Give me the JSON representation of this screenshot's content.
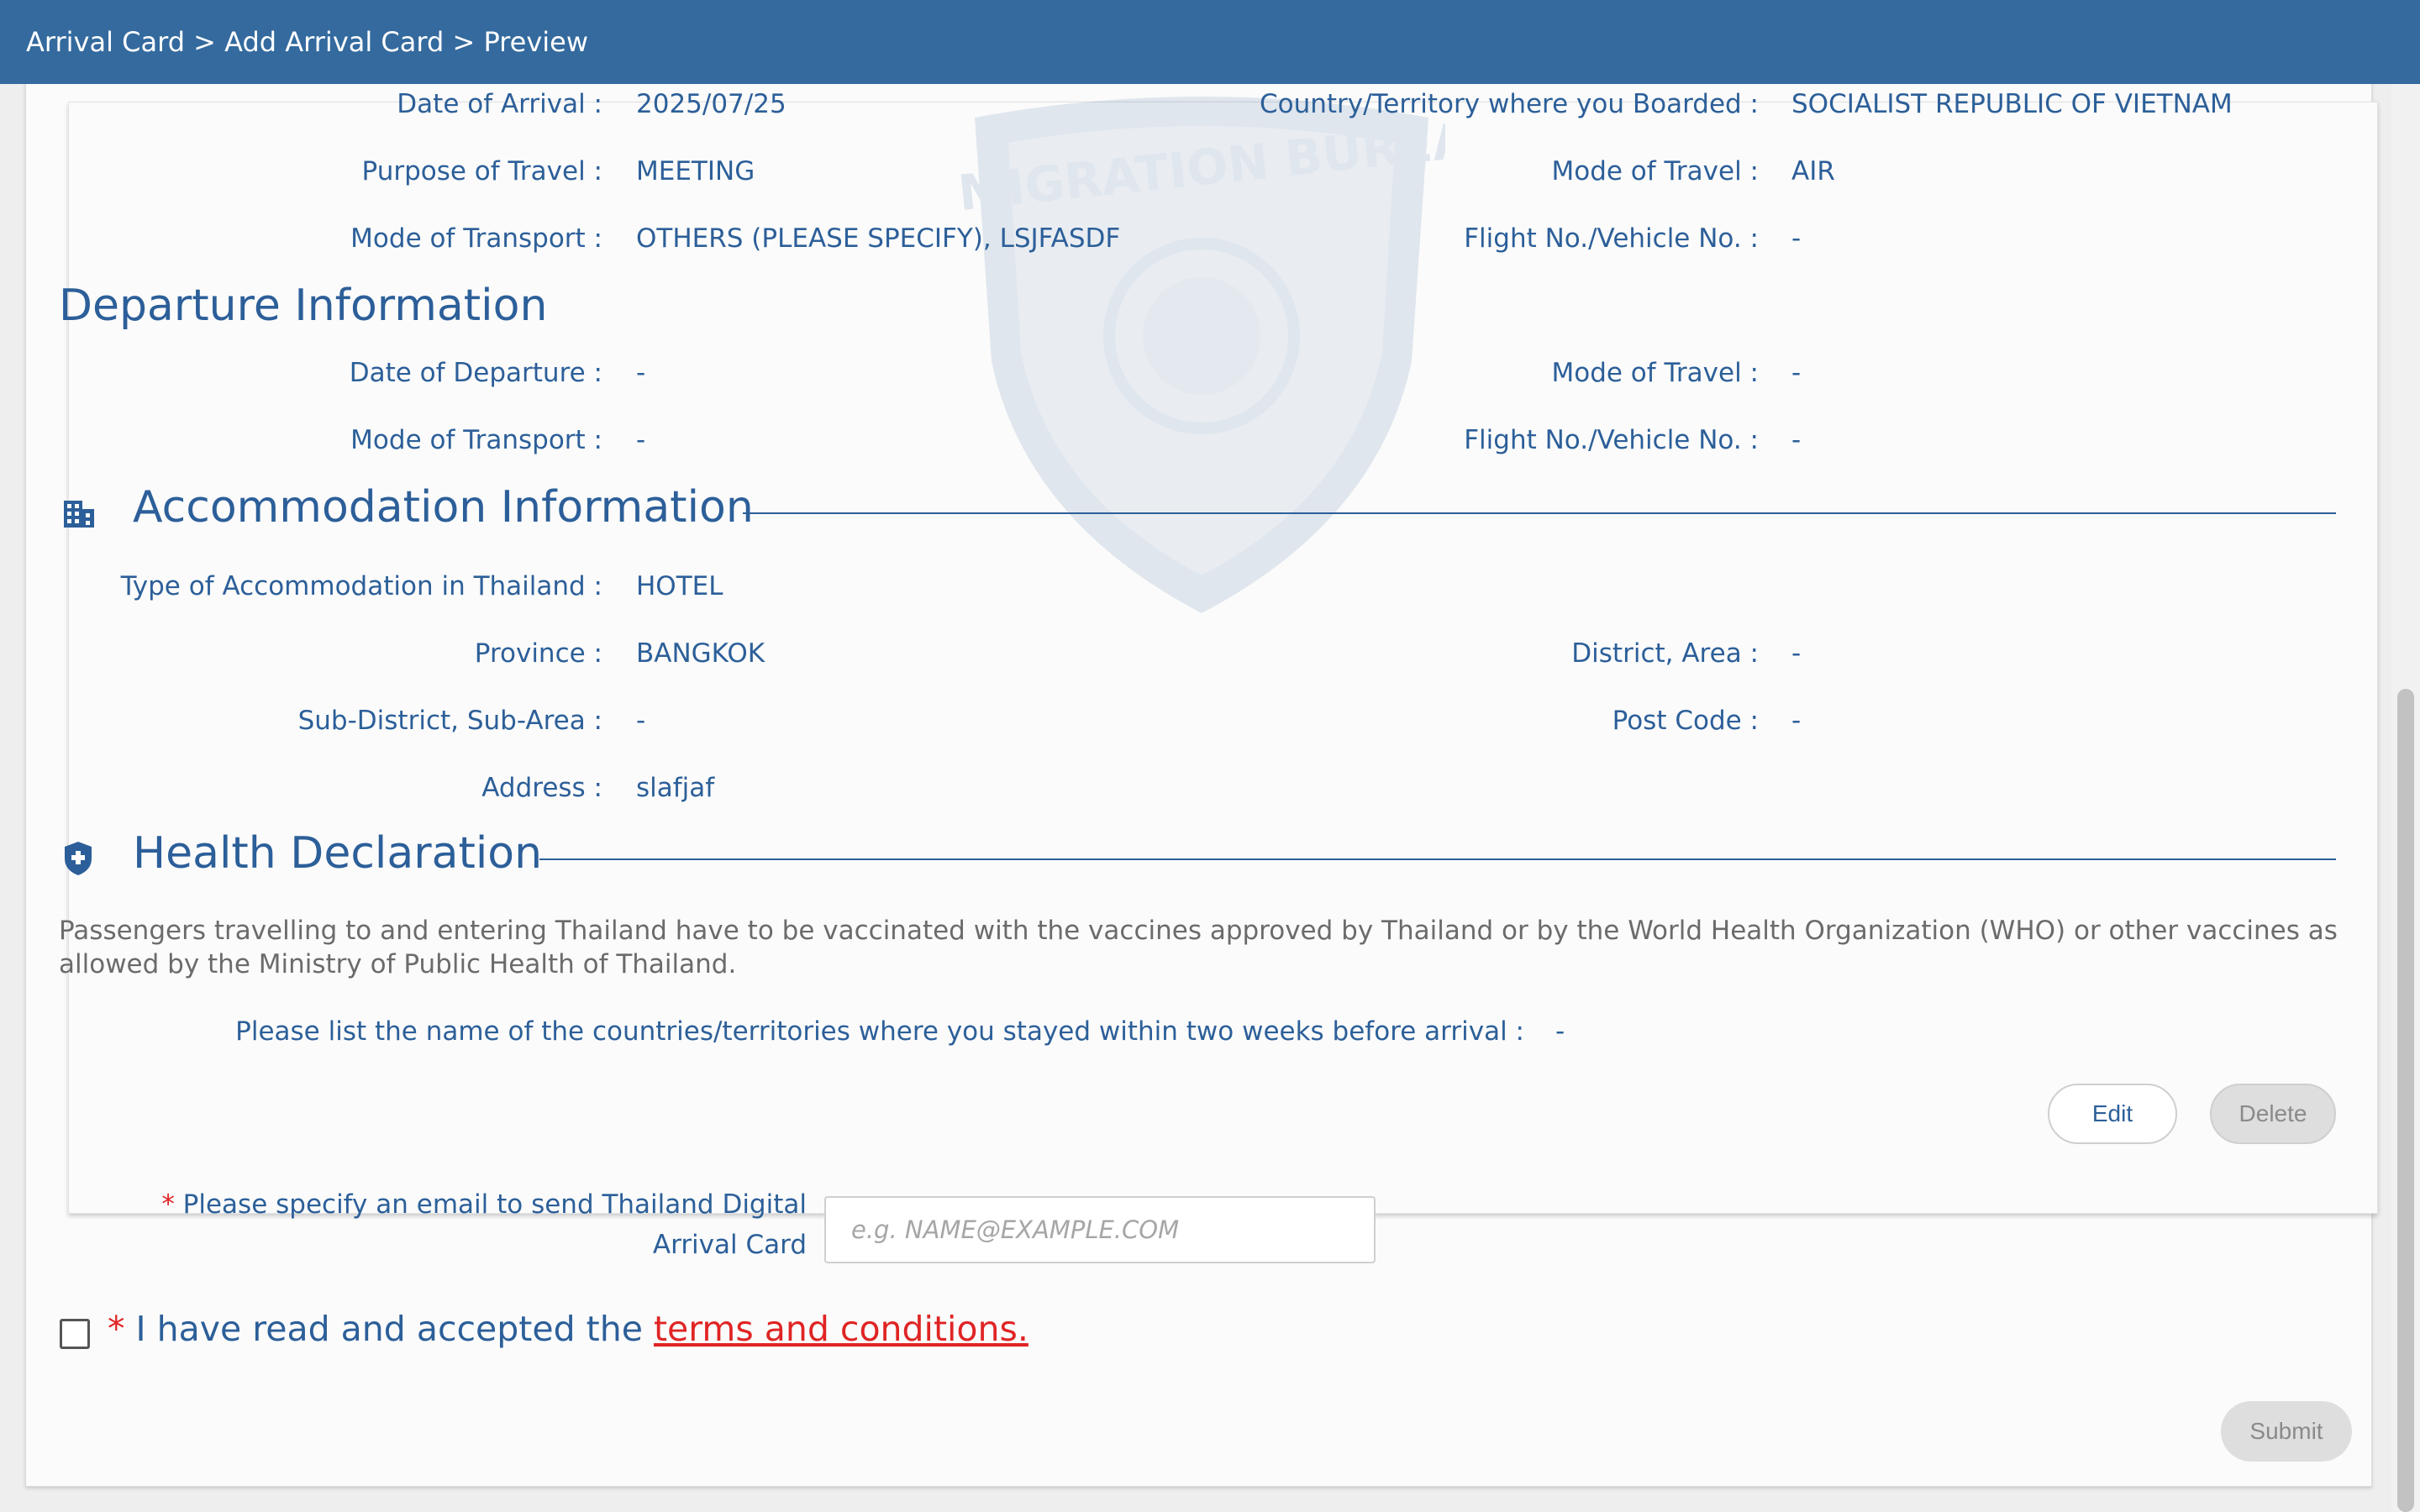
{
  "header": {
    "breadcrumb": "Arrival Card > Add Arrival Card > Preview"
  },
  "watermark": {
    "text": "IMMIGRATION BUREAU"
  },
  "arrival": {
    "rows": [
      {
        "label": "Date of Arrival :",
        "value": "2025/07/25",
        "label2": "Country/Territory where you Boarded :",
        "value2": "SOCIALIST REPUBLIC OF VIETNAM"
      },
      {
        "label": "Purpose of Travel :",
        "value": "MEETING",
        "label2": "Mode of Travel :",
        "value2": "AIR"
      },
      {
        "label": "Mode of Transport :",
        "value": "OTHERS (PLEASE SPECIFY), LSJFASDF",
        "label2": "Flight No./Vehicle No. :",
        "value2": "-"
      }
    ]
  },
  "departure": {
    "title": "Departure Information",
    "rows": [
      {
        "label": "Date of Departure :",
        "value": "-",
        "label2": "Mode of Travel :",
        "value2": "-"
      },
      {
        "label": "Mode of Transport :",
        "value": "-",
        "label2": "Flight No./Vehicle No. :",
        "value2": "-"
      }
    ]
  },
  "accommodation": {
    "title": "Accommodation Information",
    "icon": "building-icon",
    "type_label": "Type of Accommodation in Thailand :",
    "type_value": "HOTEL",
    "province_label": "Province :",
    "province_value": "BANGKOK",
    "district_label": "District, Area :",
    "district_value": "-",
    "subdistrict_label": "Sub-District, Sub-Area :",
    "subdistrict_value": "-",
    "postcode_label": "Post Code :",
    "postcode_value": "-",
    "address_label": "Address :",
    "address_value": "slafjaf"
  },
  "health": {
    "title": "Health Declaration",
    "icon": "medical-shield-icon",
    "notice": "Passengers travelling to and entering Thailand have to be vaccinated with the vaccines approved by Thailand or by the World Health Organization (WHO) or other vaccines as allowed by the Ministry of Public Health of Thailand.",
    "countries_label": "Please list the name of the countries/territories where you stayed within two weeks before arrival :",
    "countries_value": "-"
  },
  "actions": {
    "edit": "Edit",
    "delete": "Delete",
    "submit": "Submit"
  },
  "email": {
    "required_mark": "*",
    "label": "Please specify an email to send Thailand Digital Arrival Card",
    "placeholder": "e.g. NAME@EXAMPLE.COM",
    "value": ""
  },
  "terms": {
    "required_mark": "*",
    "text": "I have read and accepted the",
    "link": "terms and conditions."
  },
  "colors": {
    "header_bg": "#346a9e",
    "text_blue": "#2c5f99",
    "required_red": "#e02424"
  }
}
